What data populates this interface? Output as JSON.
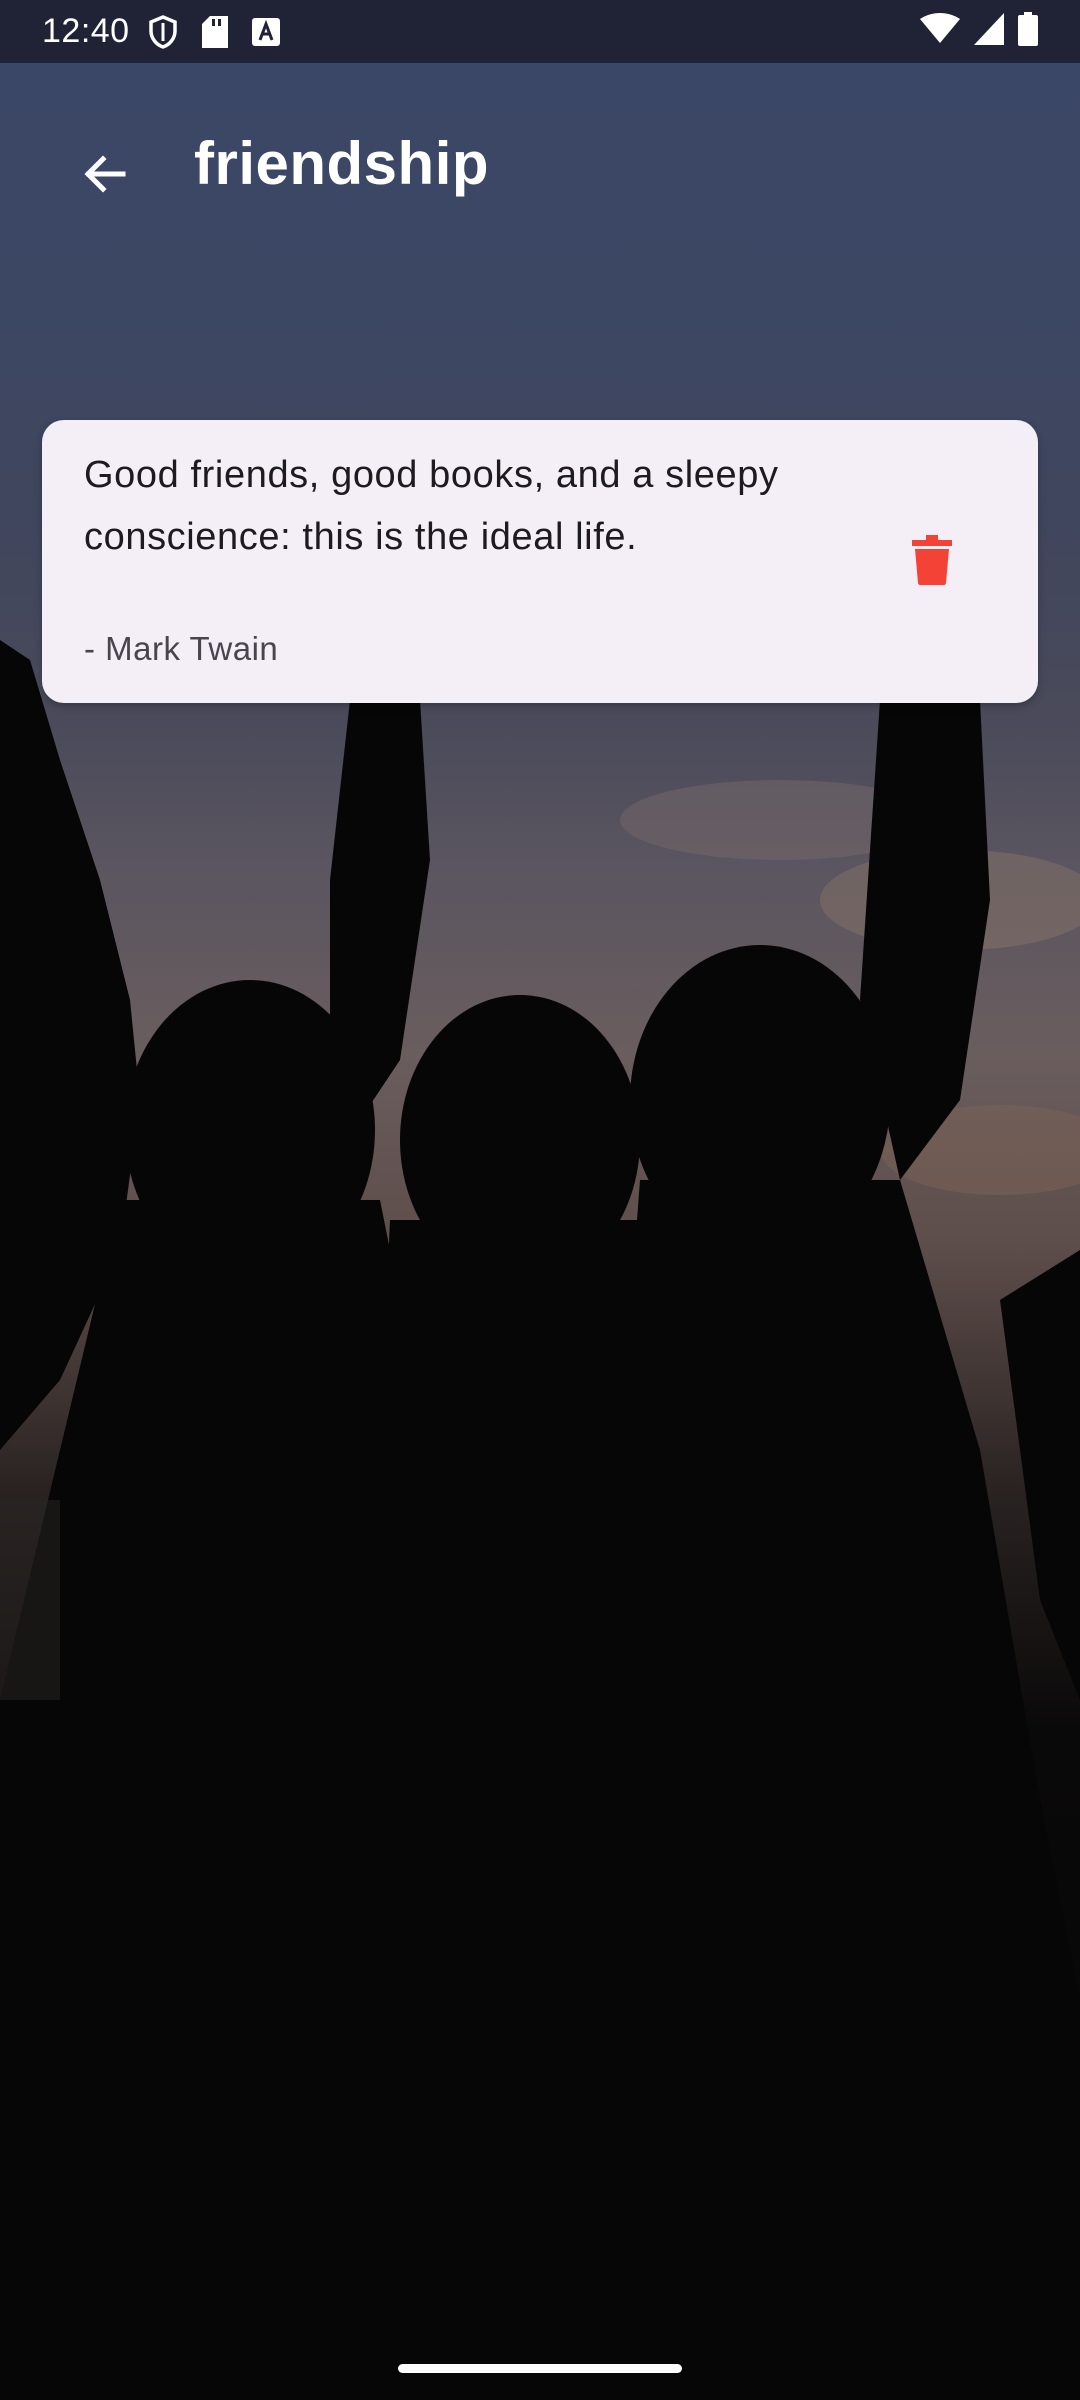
{
  "status_bar": {
    "time": "12:40",
    "left_icons": [
      "shield-icon",
      "sd-card-icon",
      "font-a-icon"
    ],
    "right_icons": [
      "wifi-icon",
      "signal-icon",
      "battery-icon"
    ]
  },
  "app_bar": {
    "back_icon": "arrow-back-icon",
    "title": "friendship"
  },
  "quotes": [
    {
      "text": "Good friends, good books, and a sleepy conscience: this is the ideal life.",
      "author": "- Mark Twain",
      "delete_icon": "trash-icon"
    }
  ],
  "colors": {
    "status_bar_bg": "#1f2335",
    "card_bg": "#f4eff7",
    "delete_red": "#f44336",
    "title_text": "#ffffff"
  },
  "background": {
    "description_icon": "silhouette-photo"
  }
}
